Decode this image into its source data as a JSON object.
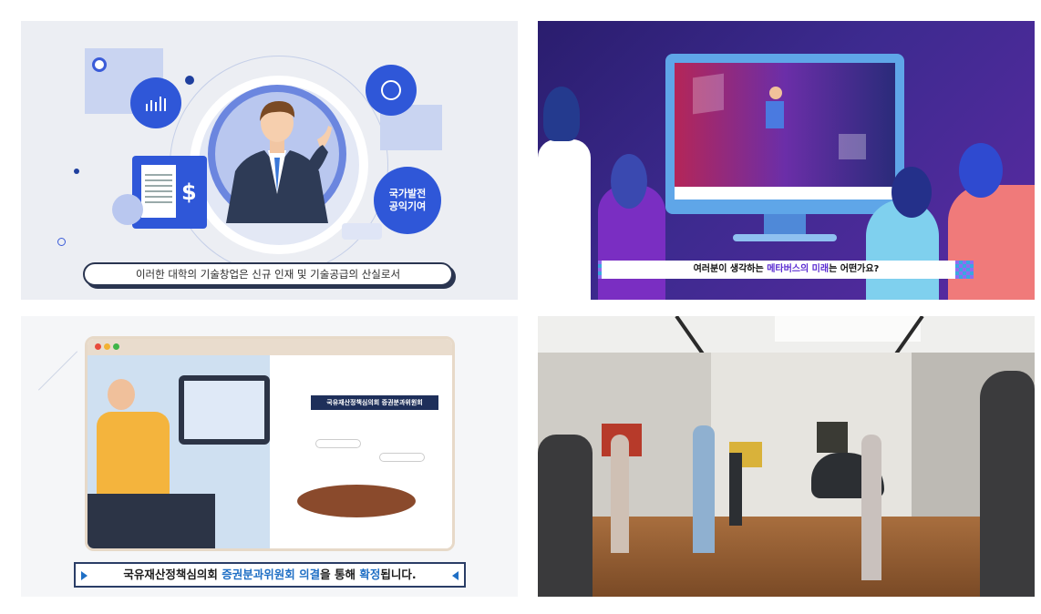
{
  "panels": [
    {
      "id": "panel-1",
      "caption": "이러한 대학의 기술창업은 신규 인재 및 기술공급의 산실로서",
      "badge_line1": "국가발전",
      "badge_line2": "공익기여",
      "dollar_symbol": "$"
    },
    {
      "id": "panel-2",
      "caption_pre": "여러분이 생각하는 ",
      "caption_highlight": "메타버스의 미래",
      "caption_post": "는 어떤가요?"
    },
    {
      "id": "panel-3",
      "council_label": "국유재산정책심의회 증권분과위원회",
      "caption_pre": "국유재산정책심의회 ",
      "caption_highlight1": "증권분과위원회 의결",
      "caption_mid": "을 통해 ",
      "caption_highlight2": "확정",
      "caption_post": "됩니다."
    },
    {
      "id": "panel-4"
    }
  ],
  "colors": {
    "accent_blue": "#2f57d8",
    "metaverse_purple": "#5a2bd1",
    "caption_blue": "#1f6fc5"
  }
}
